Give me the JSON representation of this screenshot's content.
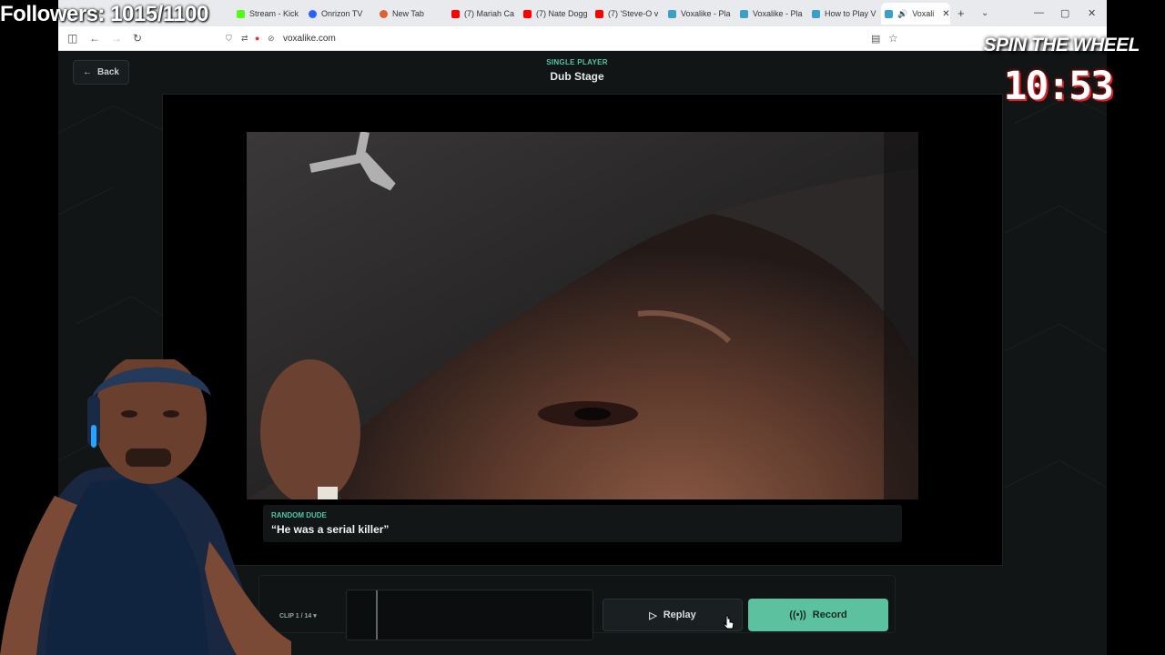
{
  "overlay": {
    "followers": "Followers: 1015/1100",
    "spin_title": "SPIN THE WHEEL",
    "timer": "10:53"
  },
  "browser": {
    "tabs": [
      {
        "label": "",
        "favicon_color": "#888"
      },
      {
        "label": "Stream - Kick",
        "favicon_color": "#53fc18"
      },
      {
        "label": "Onrizon TV",
        "favicon_color": "#2962ff"
      },
      {
        "label": "New Tab",
        "favicon_color": "#e06030"
      },
      {
        "label": "(7) Mariah Ca",
        "favicon_color": "#ff0000"
      },
      {
        "label": "(7) Nate Dogg",
        "favicon_color": "#ff0000"
      },
      {
        "label": "(7) 'Steve-O v",
        "favicon_color": "#ff0000"
      },
      {
        "label": "Voxalike - Pla",
        "favicon_color": "#3aa0c8"
      },
      {
        "label": "Voxalike - Pla",
        "favicon_color": "#3aa0c8"
      },
      {
        "label": "How to Play V",
        "favicon_color": "#3aa0c8"
      },
      {
        "label": "Voxali",
        "favicon_color": "#3aa0c8",
        "active": true
      }
    ],
    "url": "voxalike.com"
  },
  "page": {
    "back_label": "Back",
    "mode_label": "SINGLE PLAYER",
    "title": "Dub Stage",
    "caption": {
      "speaker": "RANDOM DUDE",
      "line": "“He was a serial killer”"
    },
    "clip_label": "CLIP 1 / 14",
    "replay_label": "Replay",
    "record_label": "Record",
    "accent_color": "#4fc7a4"
  }
}
